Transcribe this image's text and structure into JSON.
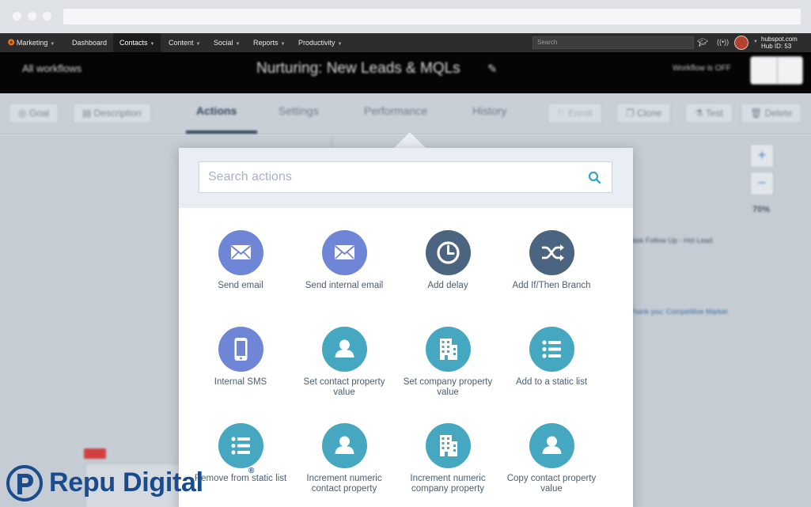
{
  "browser": {
    "url": ""
  },
  "nav": {
    "brand": "Marketing",
    "items": [
      {
        "label": "Dashboard",
        "caret": false,
        "active": false
      },
      {
        "label": "Contacts",
        "caret": true,
        "active": true
      },
      {
        "label": "Content",
        "caret": true,
        "active": false
      },
      {
        "label": "Social",
        "caret": true,
        "active": false
      },
      {
        "label": "Reports",
        "caret": true,
        "active": false
      },
      {
        "label": "Productivity",
        "caret": true,
        "active": false
      }
    ],
    "search_placeholder": "Search",
    "hub_domain": "hubspot.com",
    "hub_id": "Hub ID: 53"
  },
  "workflow": {
    "back_link": "All workflows",
    "title": "Nurturing: New Leads & MQLs",
    "status": "Workflow is OFF"
  },
  "toolbar": {
    "left_buttons": [
      "Goal",
      "Description"
    ],
    "tabs": [
      "Actions",
      "Settings",
      "Performance",
      "History"
    ],
    "active_tab": "Actions",
    "right_buttons": [
      "Enroll",
      "Clone",
      "Test",
      "Delete"
    ]
  },
  "canvas": {
    "zoom_level": "70%",
    "snippets": [
      "Task Follow Up - Hot Lead",
      "Thank you: Competitive Market"
    ]
  },
  "popover": {
    "search_placeholder": "Search actions",
    "actions": [
      {
        "label": "Send email",
        "icon": "envelope-icon",
        "color": "#6f86d6"
      },
      {
        "label": "Send internal email",
        "icon": "envelope-icon",
        "color": "#6f86d6"
      },
      {
        "label": "Add delay",
        "icon": "clock-icon",
        "color": "#4b6480"
      },
      {
        "label": "Add If/Then Branch",
        "icon": "shuffle-icon",
        "color": "#4b6480"
      },
      {
        "label": "Internal SMS",
        "icon": "phone-icon",
        "color": "#6f86d6"
      },
      {
        "label": "Set contact property value",
        "icon": "contact-icon",
        "color": "#45a7c0"
      },
      {
        "label": "Set company property value",
        "icon": "building-icon",
        "color": "#45a7c0"
      },
      {
        "label": "Add to a static list",
        "icon": "list-icon",
        "color": "#45a7c0"
      },
      {
        "label": "Remove from static list",
        "icon": "list-icon",
        "color": "#45a7c0"
      },
      {
        "label": "Increment numeric contact property",
        "icon": "contact-icon",
        "color": "#45a7c0"
      },
      {
        "label": "Increment numeric company property",
        "icon": "building-icon",
        "color": "#45a7c0"
      },
      {
        "label": "Copy contact property value",
        "icon": "contact-icon",
        "color": "#45a7c0"
      }
    ]
  },
  "watermark": {
    "text": "Repu Digital",
    "reg": "®"
  }
}
